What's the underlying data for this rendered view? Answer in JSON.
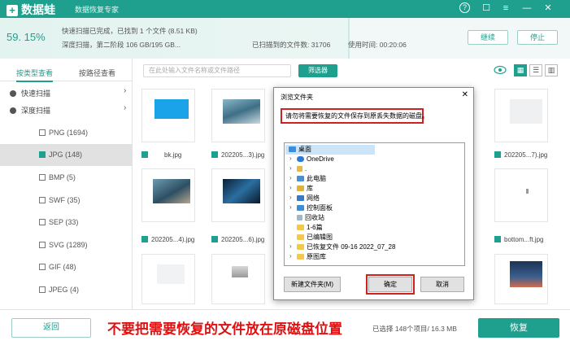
{
  "app": {
    "name": "数据蛙",
    "subtitle": "数据恢复专家",
    "accent": "#1fa08e"
  },
  "window_controls": {
    "help": "?",
    "feedback": "☐",
    "menu": "≡",
    "minimize": "—",
    "close": "✕"
  },
  "scan": {
    "percent": "59. 15%",
    "progress_fraction": 0.5915,
    "line1": "快速扫描已完成，已找到 1 个文件 (8.51 KB)",
    "line2": "深度扫描，第二阶段 106 GB/195 GB...",
    "found_label": "已扫描到的文件数:   31706",
    "time_label": "使用时间:   00:20:06",
    "continue_button": "继续",
    "stop_button": "停止"
  },
  "sidebar": {
    "tab_type": "按类型查看",
    "tab_path": "按路径查看",
    "quick_scan": "快速扫描",
    "deep_scan": "深度扫描",
    "chevron": "›",
    "types": [
      {
        "label": "PNG (1694)",
        "checked": false
      },
      {
        "label": "JPG (148)",
        "checked": true
      },
      {
        "label": "BMP (5)",
        "checked": false
      },
      {
        "label": "SWF (35)",
        "checked": false
      },
      {
        "label": "SEP (33)",
        "checked": false
      },
      {
        "label": "SVG (1289)",
        "checked": false
      },
      {
        "label": "GIF (48)",
        "checked": false
      },
      {
        "label": "JPEG (4)",
        "checked": false
      }
    ]
  },
  "toolbar": {
    "search_placeholder": "在此处输入文件名称或文件路径",
    "filter_button": "筛选器",
    "eye_icon": "eye-icon",
    "grid_icon": "▦",
    "list_icon": "☰",
    "detail_icon": "▥"
  },
  "files": [
    {
      "name": "bk.jpg"
    },
    {
      "name": "202205...3).jpg"
    },
    {
      "name": "202205...7).jpg"
    },
    {
      "name": "202205...4).jpg"
    },
    {
      "name": "202205...6).jpg"
    },
    {
      "name": "bottom...ft.jpg"
    }
  ],
  "dialog": {
    "title": "浏览文件夹",
    "close": "✕",
    "message": "请勿将需要恢复的文件保存到原丢失数据的磁盘。",
    "tree": [
      {
        "label": "桌面",
        "selected": true,
        "arrow": ""
      },
      {
        "label": "OneDrive",
        "arrow": "›"
      },
      {
        "label": ".",
        "arrow": "›"
      },
      {
        "label": "此电脑",
        "arrow": "›"
      },
      {
        "label": "库",
        "arrow": "›"
      },
      {
        "label": "网络",
        "arrow": "›"
      },
      {
        "label": "控制面板",
        "arrow": "›"
      },
      {
        "label": "回收站",
        "arrow": ""
      },
      {
        "label": "1-6篇",
        "arrow": ""
      },
      {
        "label": "已编辑图",
        "arrow": ""
      },
      {
        "label": "已恢复文件 09-16 2022_07_28",
        "arrow": "›"
      },
      {
        "label": "原图库",
        "arrow": "›"
      }
    ],
    "new_folder_button": "新建文件夹(M)",
    "ok_button": "确定",
    "cancel_button": "取消"
  },
  "bottom": {
    "back_button": "返回",
    "warning": "不要把需要恢复的文件放在原磁盘位置",
    "selection_info": "已选择 148个项目/ 16.3 MB",
    "recover_button": "恢复"
  }
}
